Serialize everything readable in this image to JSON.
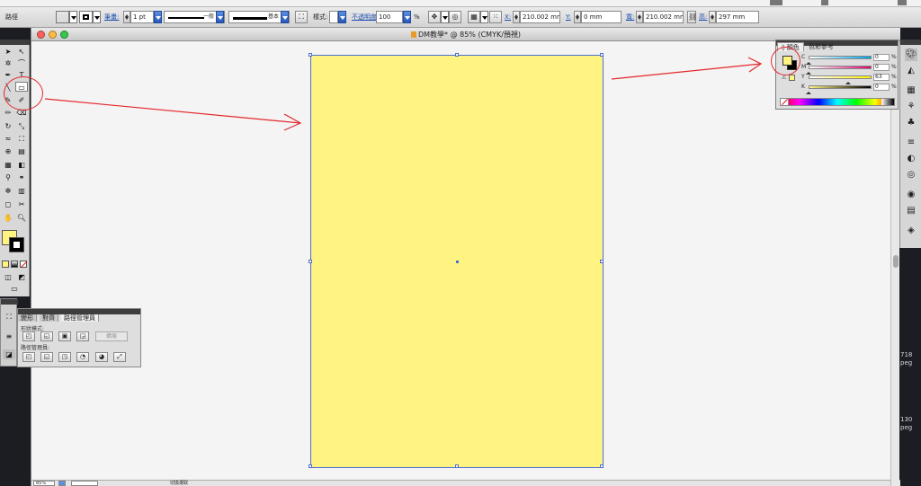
{
  "control_bar": {
    "path_label": "路徑",
    "fill_color": "#fff382",
    "stroke_label": "筆畫:",
    "stroke_weight": "1 pt",
    "stroke_style_label": "一般",
    "brush_label": "基本",
    "style_label": "樣式:",
    "opacity_label": "不透明度:",
    "opacity_value": "100",
    "opacity_unit": "%",
    "x_label": "X:",
    "x_value": "210.002 mm",
    "y_label": "Y:",
    "y_value": "0 mm",
    "w_label": "寬:",
    "w_value": "210.002 mm",
    "h_label": "高:",
    "h_value": "297 mm"
  },
  "document": {
    "title": "DM教學* @ 85% (CMYK/預視)",
    "artboard_color": "#fff382",
    "zoom": "85%",
    "status_text": "切換選取"
  },
  "color_panel": {
    "tab_color": "顏色",
    "tab_guide": "色彩參考",
    "channels": [
      {
        "label": "C",
        "value": "0",
        "unit": "%",
        "from": "#ffffff",
        "to": "#00a0e0",
        "pos": 0.0
      },
      {
        "label": "M",
        "value": "0",
        "unit": "%",
        "from": "#ffffff",
        "to": "#e0006e",
        "pos": 0.0
      },
      {
        "label": "Y",
        "value": "63",
        "unit": "%",
        "from": "#ffffff",
        "to": "#ffee00",
        "pos": 0.63
      },
      {
        "label": "K",
        "value": "0",
        "unit": "%",
        "from": "#fff382",
        "to": "#000000",
        "pos": 0.0
      }
    ]
  },
  "pathfinder": {
    "tabs": [
      "變形",
      "對齊",
      "路徑管理員"
    ],
    "shape_modes_label": "形狀模式:",
    "pathfinders_label": "路徑管理員:",
    "expand_label": "擴展"
  },
  "desktop": {
    "file1_size": "718",
    "file1_ext": "peg",
    "file2_size": "130",
    "file2_ext": "peg"
  },
  "colors": {
    "annotation": "#e4282c",
    "selection": "#4d6fcc"
  }
}
